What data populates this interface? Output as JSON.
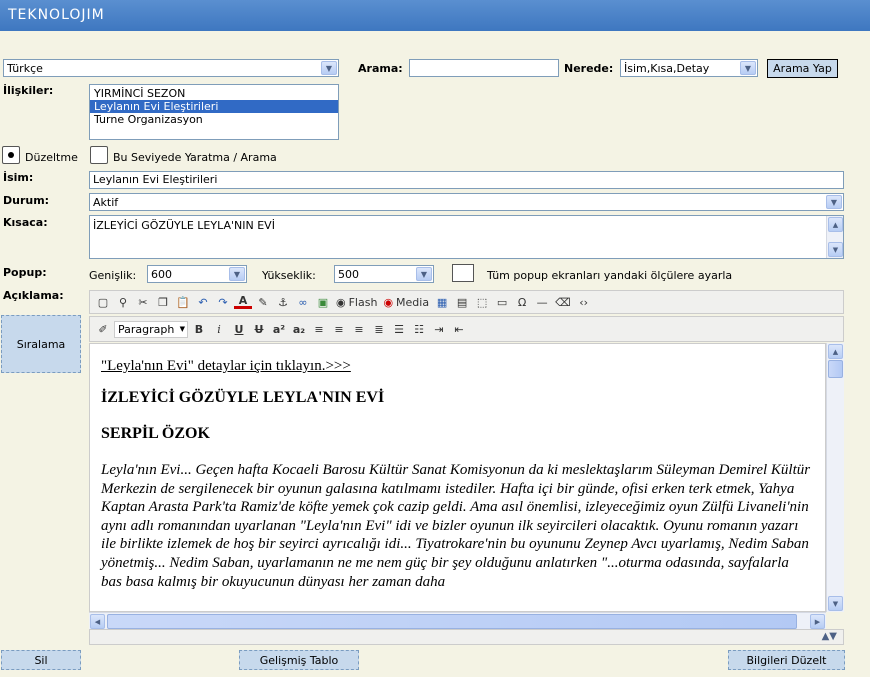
{
  "app": {
    "logo": "TEKNOLOJIM"
  },
  "language_select": {
    "value": "Türkçe"
  },
  "search": {
    "label": "Arama:",
    "value": "",
    "where_label": "Nerede:",
    "where_value": "İsim,Kısa,Detay",
    "button": "Arama Yap"
  },
  "relations": {
    "label": "İlişkiler:",
    "items": [
      "YIRMİNCİ SEZON",
      "Leylanın Evi Eleştirileri",
      "Turne Organizasyon"
    ],
    "selected_index": 1
  },
  "mode": {
    "edit_label": "Düzeltme",
    "create_label": "Bu Seviyede Yaratma / Arama",
    "selected": "edit"
  },
  "name": {
    "label": "İsim:",
    "value": "Leylanın Evi Eleştirileri"
  },
  "status": {
    "label": "Durum:",
    "value": "Aktif"
  },
  "summary": {
    "label": "Kısaca:",
    "value": "İZLEYİCİ GÖZÜYLE LEYLA'NIN EVİ"
  },
  "popup": {
    "label": "Popup:",
    "width_label": "Genişlik:",
    "width_value": "600",
    "height_label": "Yükseklik:",
    "height_value": "500",
    "apply_all_label": "Tüm popup ekranları yandaki ölçülere ayarla"
  },
  "description": {
    "label": "Açıklama:"
  },
  "toolbar": {
    "flash_label": "Flash",
    "media_label": "Media",
    "format_value": "Paragraph"
  },
  "editor": {
    "link_text": "\"Leyla'nın Evi\" detaylar için tıklayın.>>>",
    "heading1": "İZLEYİCİ GÖZÜYLE LEYLA'NIN EVİ",
    "heading2": "SERPİL ÖZOK",
    "paragraph": "Leyla'nın Evi... Geçen hafta Kocaeli Barosu Kültür Sanat Komisyonun da ki meslektaşlarım Süleyman Demirel Kültür Merkezin de sergilenecek bir oyunun galasına katılmamı istediler. Hafta içi bir günde, ofisi erken terk etmek, Yahya Kaptan Arasta Park'ta Ramiz'de köfte yemek çok cazip geldi. Ama asıl önemlisi, izleyeceğimiz oyun Zülfü Livaneli'nin aynı adlı romanından uyarlanan \"Leyla'nın Evi\" idi ve bizler oyunun ilk seyircileri olacaktık. Oyunu romanın yazarı ile birlikte izlemek de hoş bir seyirci ayrıcalığı idi... Tiyatrokare'nin bu oyununu Zeynep Avcı uyarlamış, Nedim Saban yönetmiş... Nedim Saban, uyarlamanın ne me nem güç bir şey olduğunu anlatırken \"...oturma odasında, sayfalarla bas basa kalmış bir okuyucunun dünyası her zaman daha"
  },
  "buttons": {
    "sort": "Sıralama",
    "delete": "Sil",
    "advanced_table": "Gelişmiş Tablo",
    "update": "Bilgileri Düzelt"
  }
}
